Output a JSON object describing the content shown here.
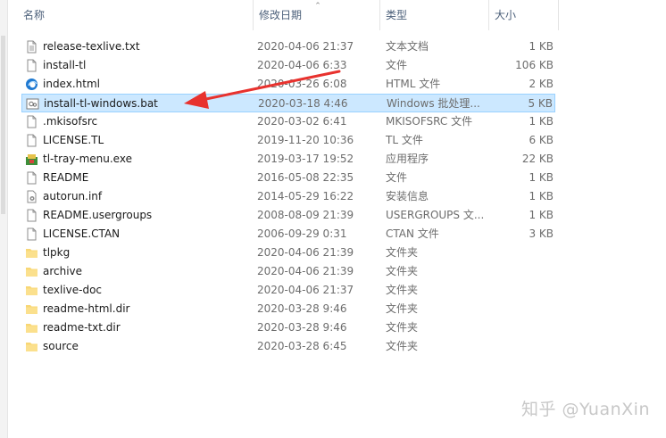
{
  "columns": {
    "name": "名称",
    "date": "修改日期",
    "type": "类型",
    "size": "大小"
  },
  "icons": {
    "sort": "chevron-up-icon",
    "txt": "text-document-icon",
    "file": "blank-file-icon",
    "html": "edge-browser-icon",
    "bat": "batch-file-icon",
    "exe": "tray-menu-app-icon",
    "inf": "setup-info-icon",
    "folder": "folder-icon"
  },
  "colors": {
    "selected_bg": "#cce8ff",
    "selected_border": "#99d1ff",
    "arrow": "#e8322e",
    "folder": "#f8d775"
  },
  "files": [
    {
      "name": "release-texlive.txt",
      "date": "2020-04-06 21:37",
      "type": "文本文档",
      "size": "1 KB",
      "icon": "txt"
    },
    {
      "name": "install-tl",
      "date": "2020-04-06 6:33",
      "type": "文件",
      "size": "106 KB",
      "icon": "file"
    },
    {
      "name": "index.html",
      "date": "2020-03-26 6:08",
      "type": "HTML 文件",
      "size": "2 KB",
      "icon": "html"
    },
    {
      "name": "install-tl-windows.bat",
      "date": "2020-03-18 4:46",
      "type": "Windows 批处理...",
      "size": "5 KB",
      "icon": "bat",
      "selected": true
    },
    {
      "name": ".mkisofsrc",
      "date": "2020-03-02 6:41",
      "type": "MKISOFSRC 文件",
      "size": "1 KB",
      "icon": "file"
    },
    {
      "name": "LICENSE.TL",
      "date": "2019-11-20 10:36",
      "type": "TL 文件",
      "size": "6 KB",
      "icon": "file"
    },
    {
      "name": "tl-tray-menu.exe",
      "date": "2019-03-17 19:52",
      "type": "应用程序",
      "size": "22 KB",
      "icon": "exe"
    },
    {
      "name": "README",
      "date": "2016-05-08 22:35",
      "type": "文件",
      "size": "1 KB",
      "icon": "file"
    },
    {
      "name": "autorun.inf",
      "date": "2014-05-29 16:22",
      "type": "安装信息",
      "size": "1 KB",
      "icon": "inf"
    },
    {
      "name": "README.usergroups",
      "date": "2008-08-09 21:39",
      "type": "USERGROUPS 文...",
      "size": "1 KB",
      "icon": "file"
    },
    {
      "name": "LICENSE.CTAN",
      "date": "2006-09-29 0:31",
      "type": "CTAN 文件",
      "size": "3 KB",
      "icon": "file"
    },
    {
      "name": "tlpkg",
      "date": "2020-04-06 21:39",
      "type": "文件夹",
      "size": "",
      "icon": "folder"
    },
    {
      "name": "archive",
      "date": "2020-04-06 21:39",
      "type": "文件夹",
      "size": "",
      "icon": "folder"
    },
    {
      "name": "texlive-doc",
      "date": "2020-04-06 21:37",
      "type": "文件夹",
      "size": "",
      "icon": "folder"
    },
    {
      "name": "readme-html.dir",
      "date": "2020-03-28 9:46",
      "type": "文件夹",
      "size": "",
      "icon": "folder"
    },
    {
      "name": "readme-txt.dir",
      "date": "2020-03-28 9:46",
      "type": "文件夹",
      "size": "",
      "icon": "folder"
    },
    {
      "name": "source",
      "date": "2020-03-28 6:45",
      "type": "文件夹",
      "size": "",
      "icon": "folder"
    }
  ],
  "watermark": "知乎 @YuanXin"
}
